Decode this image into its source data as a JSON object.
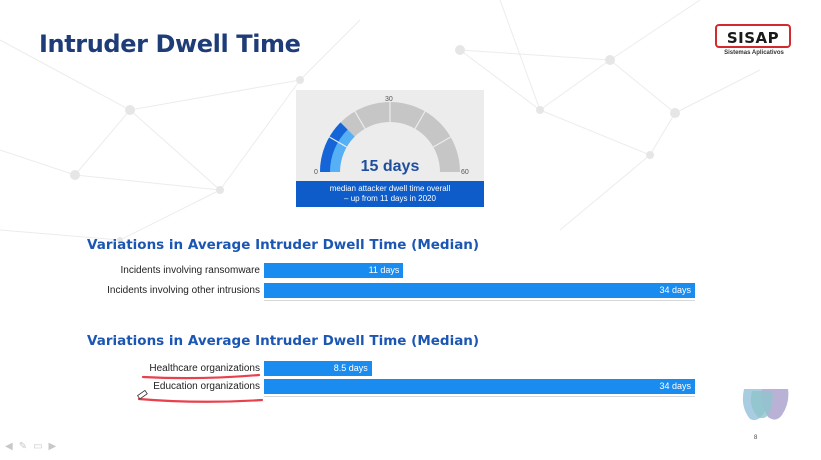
{
  "slide": {
    "title": "Intruder Dwell Time",
    "page_number": "8"
  },
  "logo": {
    "name": "SISAP",
    "tagline": "Sistemas Aplicativos"
  },
  "gauge": {
    "min_label": "0",
    "mid_label": "30",
    "max_label": "60",
    "value": 15,
    "max": 60,
    "value_label": "15 days",
    "caption_line1": "median attacker dwell time overall",
    "caption_line2": "– up from 11 days in 2020"
  },
  "sections": [
    {
      "heading": "Variations in Average Intruder Dwell Time (Median)",
      "rows": [
        {
          "label": "Incidents involving ransomware",
          "value": 11,
          "value_label": "11 days"
        },
        {
          "label": "Incidents involving other intrusions",
          "value": 34,
          "value_label": "34 days"
        }
      ]
    },
    {
      "heading": "Variations in Average Intruder Dwell Time (Median)",
      "rows": [
        {
          "label": "Healthcare organizations",
          "value": 8.5,
          "value_label": "8.5 days"
        },
        {
          "label": "Education organizations",
          "value": 34,
          "value_label": "34 days"
        }
      ]
    }
  ],
  "colors": {
    "title": "#1d3c78",
    "heading": "#1c56b3",
    "bar": "#1a8cf0",
    "gauge_dark": "#1565d8",
    "gauge_light": "#55b0f5",
    "gauge_track": "#c6c6c6",
    "caption_bg": "#0d5cc9",
    "annotation": "#e8404c"
  },
  "icons": {
    "nav_back": "arrow-left-icon",
    "nav_pen": "pen-icon",
    "nav_menu": "menu-icon",
    "nav_forward": "arrow-right-icon",
    "meeting_logo": "teams-logo-icon"
  }
}
